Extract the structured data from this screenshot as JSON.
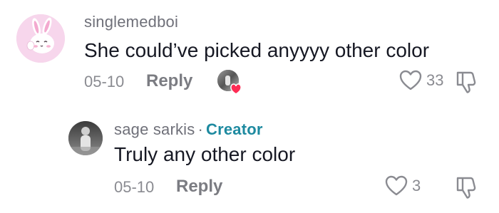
{
  "comments": [
    {
      "username": "singlemedboi",
      "text": "She could’ve picked anyyyy other color",
      "date": "05-10",
      "reply_label": "Reply",
      "like_count": "33",
      "avatar_icon": "bunny-avatar",
      "creator_liked": true
    }
  ],
  "replies": [
    {
      "username": "sage sarkis",
      "separator": "·",
      "badge": "Creator",
      "text": "Truly any other color",
      "date": "05-10",
      "reply_label": "Reply",
      "like_count": "3",
      "avatar_icon": "photo-avatar"
    }
  ],
  "colors": {
    "creator_badge": "#1e8aa0",
    "username": "#6f7079",
    "meta": "#8a8b91",
    "heart_red": "#fe2c55",
    "bunny_bg": "#f6d4ea"
  }
}
